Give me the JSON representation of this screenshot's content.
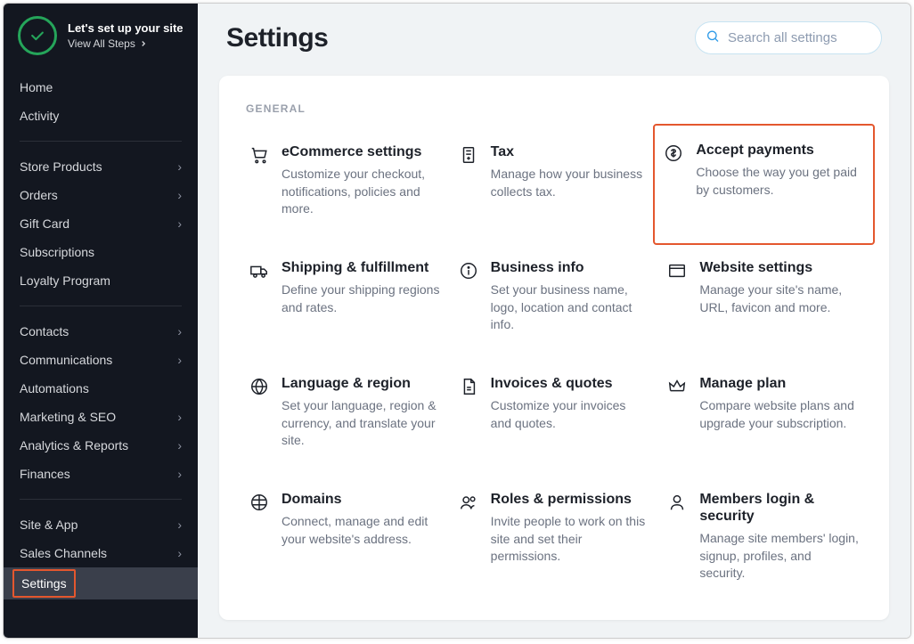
{
  "setup": {
    "title": "Let's set up your site",
    "link": "View All Steps"
  },
  "nav": {
    "home": "Home",
    "activity": "Activity",
    "storeProducts": "Store Products",
    "orders": "Orders",
    "giftCard": "Gift Card",
    "subscriptions": "Subscriptions",
    "loyalty": "Loyalty Program",
    "contacts": "Contacts",
    "communications": "Communications",
    "automations": "Automations",
    "marketing": "Marketing & SEO",
    "analytics": "Analytics & Reports",
    "finances": "Finances",
    "siteApp": "Site & App",
    "salesChannels": "Sales Channels",
    "settings": "Settings"
  },
  "header": {
    "title": "Settings",
    "searchPlaceholder": "Search all settings"
  },
  "section": {
    "general": "GENERAL"
  },
  "tiles": {
    "ecom": {
      "title": "eCommerce settings",
      "desc": "Customize your checkout, notifications, policies and more."
    },
    "tax": {
      "title": "Tax",
      "desc": "Manage how your business collects tax."
    },
    "accept": {
      "title": "Accept payments",
      "desc": "Choose the way you get paid by customers."
    },
    "shipping": {
      "title": "Shipping & fulfillment",
      "desc": "Define your shipping regions and rates."
    },
    "bizinfo": {
      "title": "Business info",
      "desc": "Set your business name, logo, location and contact info."
    },
    "website": {
      "title": "Website settings",
      "desc": "Manage your site's name, URL, favicon and more."
    },
    "lang": {
      "title": "Language & region",
      "desc": "Set your language, region & currency, and translate your site."
    },
    "invoices": {
      "title": "Invoices & quotes",
      "desc": "Customize your invoices and quotes."
    },
    "plan": {
      "title": "Manage plan",
      "desc": "Compare website plans and upgrade your subscription."
    },
    "domains": {
      "title": "Domains",
      "desc": "Connect, manage and edit your website's address."
    },
    "roles": {
      "title": "Roles & permissions",
      "desc": "Invite people to work on this site and set their permissions."
    },
    "members": {
      "title": "Members login & security",
      "desc": "Manage site members' login, signup, profiles, and security."
    }
  }
}
